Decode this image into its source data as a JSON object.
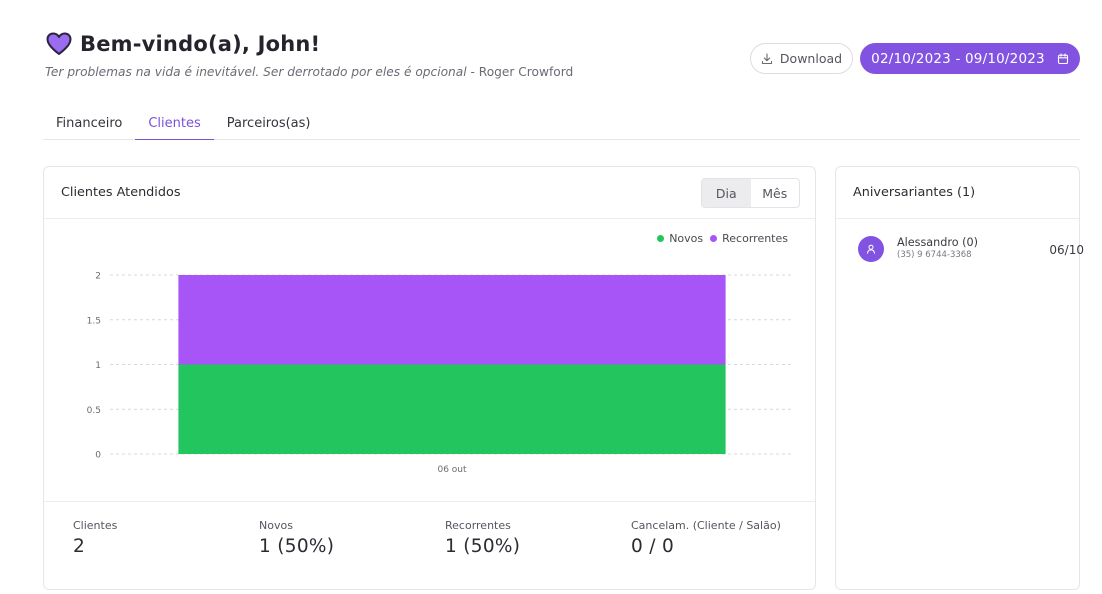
{
  "header": {
    "title": "Bem-vindo(a), John!",
    "quote": "Ter problemas na vida é inevitável. Ser derrotado por eles é opcional",
    "author": " - Roger Crowford"
  },
  "actions": {
    "download_label": "Download",
    "date_range": "02/10/2023 - 09/10/2023"
  },
  "tabs": [
    {
      "label": "Financeiro",
      "active": false
    },
    {
      "label": "Clientes",
      "active": true
    },
    {
      "label": "Parceiros(as)",
      "active": false
    }
  ],
  "colors": {
    "accent": "#8153e0",
    "novos": "#22c55e",
    "recorrentes": "#a855f7"
  },
  "main_card": {
    "title": "Clientes Atendidos",
    "toggle": [
      {
        "label": "Dia",
        "active": true
      },
      {
        "label": "Mês",
        "active": false
      }
    ]
  },
  "chart_data": {
    "type": "bar",
    "stacked": true,
    "categories": [
      "06 out"
    ],
    "series": [
      {
        "name": "Novos",
        "color": "#22c55e",
        "values": [
          1
        ]
      },
      {
        "name": "Recorrentes",
        "color": "#a855f7",
        "values": [
          1
        ]
      }
    ],
    "ylim": [
      0,
      2
    ],
    "yticks": [
      "0",
      "0.5",
      "1",
      "1.5",
      "2"
    ],
    "grid": true,
    "legend_position": "top-right",
    "title": "",
    "xlabel": "",
    "ylabel": ""
  },
  "stats": [
    {
      "label": "Clientes",
      "value": "2"
    },
    {
      "label": "Novos",
      "value": "1 (50%)"
    },
    {
      "label": "Recorrentes",
      "value": "1 (50%)"
    },
    {
      "label": "Cancelam. (Cliente / Salão)",
      "value": "0 / 0"
    }
  ],
  "birthdays": {
    "title": "Aniversariantes (1)",
    "items": [
      {
        "name": "Alessandro (0)",
        "phone": "(35) 9 6744-3368",
        "date": "06/10"
      }
    ]
  }
}
